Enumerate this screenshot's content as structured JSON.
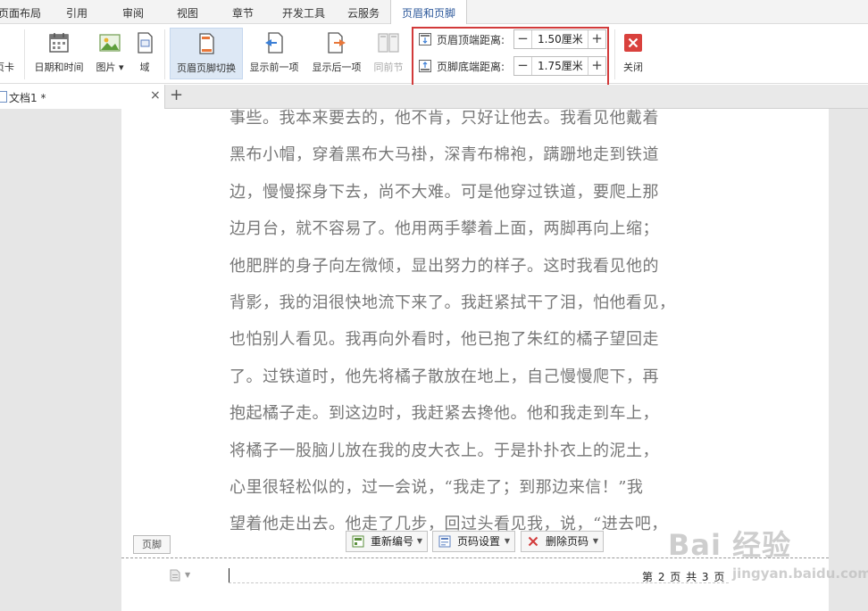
{
  "menu": {
    "tabs": [
      "页面布局",
      "引用",
      "审阅",
      "视图",
      "章节",
      "开发工具",
      "云服务",
      "页眉和页脚"
    ],
    "active_tab": "页眉和页脚"
  },
  "ribbon": {
    "partial_left_label": "页卡",
    "buttons": {
      "datetime": "日期和时间",
      "picture": "图片",
      "field": "域",
      "switch_header_footer": "页眉页脚切换",
      "show_previous": "显示前一项",
      "show_next": "显示后一项",
      "same_as_previous": "同前节",
      "close": "关闭"
    },
    "header_top_distance": {
      "label": "页眉顶端距离:",
      "value": "1.50厘米"
    },
    "footer_bottom_distance": {
      "label": "页脚底端距离:",
      "value": "1.75厘米"
    },
    "stepper_minus": "−",
    "stepper_plus": "+"
  },
  "document_tab": {
    "title": "文档1 *",
    "close": "×",
    "new_tab": "+"
  },
  "document": {
    "lines": [
      "事些。我本来要去的，他不肯，只好让他去。我看见他戴着",
      "黑布小帽，穿着黑布大马褂，深青布棉袍，蹒跚地走到铁道",
      "边，慢慢探身下去，尚不大难。可是他穿过铁道，要爬上那",
      "边月台，就不容易了。他用两手攀着上面，两脚再向上缩；",
      "他肥胖的身子向左微倾，显出努力的样子。这时我看见他的",
      "背影，我的泪很快地流下来了。我赶紧拭干了泪，怕他看见，",
      "也怕别人看见。我再向外看时，他已抱了朱红的橘子望回走",
      "了。过铁道时，他先将橘子散放在地上，自己慢慢爬下，再",
      "抱起橘子走。到这边时，我赶紧去搀他。他和我走到车上，",
      "将橘子一股脑儿放在我的皮大衣上。于是扑扑衣上的泥土，",
      "心里很轻松似的，过一会说，“我走了；到那边来信！”我",
      "望着他走出去。他走了几步，回过头看见我，说，“进去吧，"
    ]
  },
  "footer": {
    "tag": "页脚",
    "buttons": {
      "renumber": "重新编号",
      "page_number_settings": "页码设置",
      "delete_page_number": "删除页码"
    },
    "page_number": "第 2 页 共 3 页"
  },
  "watermark": {
    "main": "Bai 经验",
    "sub": "jingyan.baidu.com"
  },
  "colors": {
    "accent": "#2b579a",
    "highlight_border": "#d23a3a",
    "close_red": "#d9413d"
  }
}
